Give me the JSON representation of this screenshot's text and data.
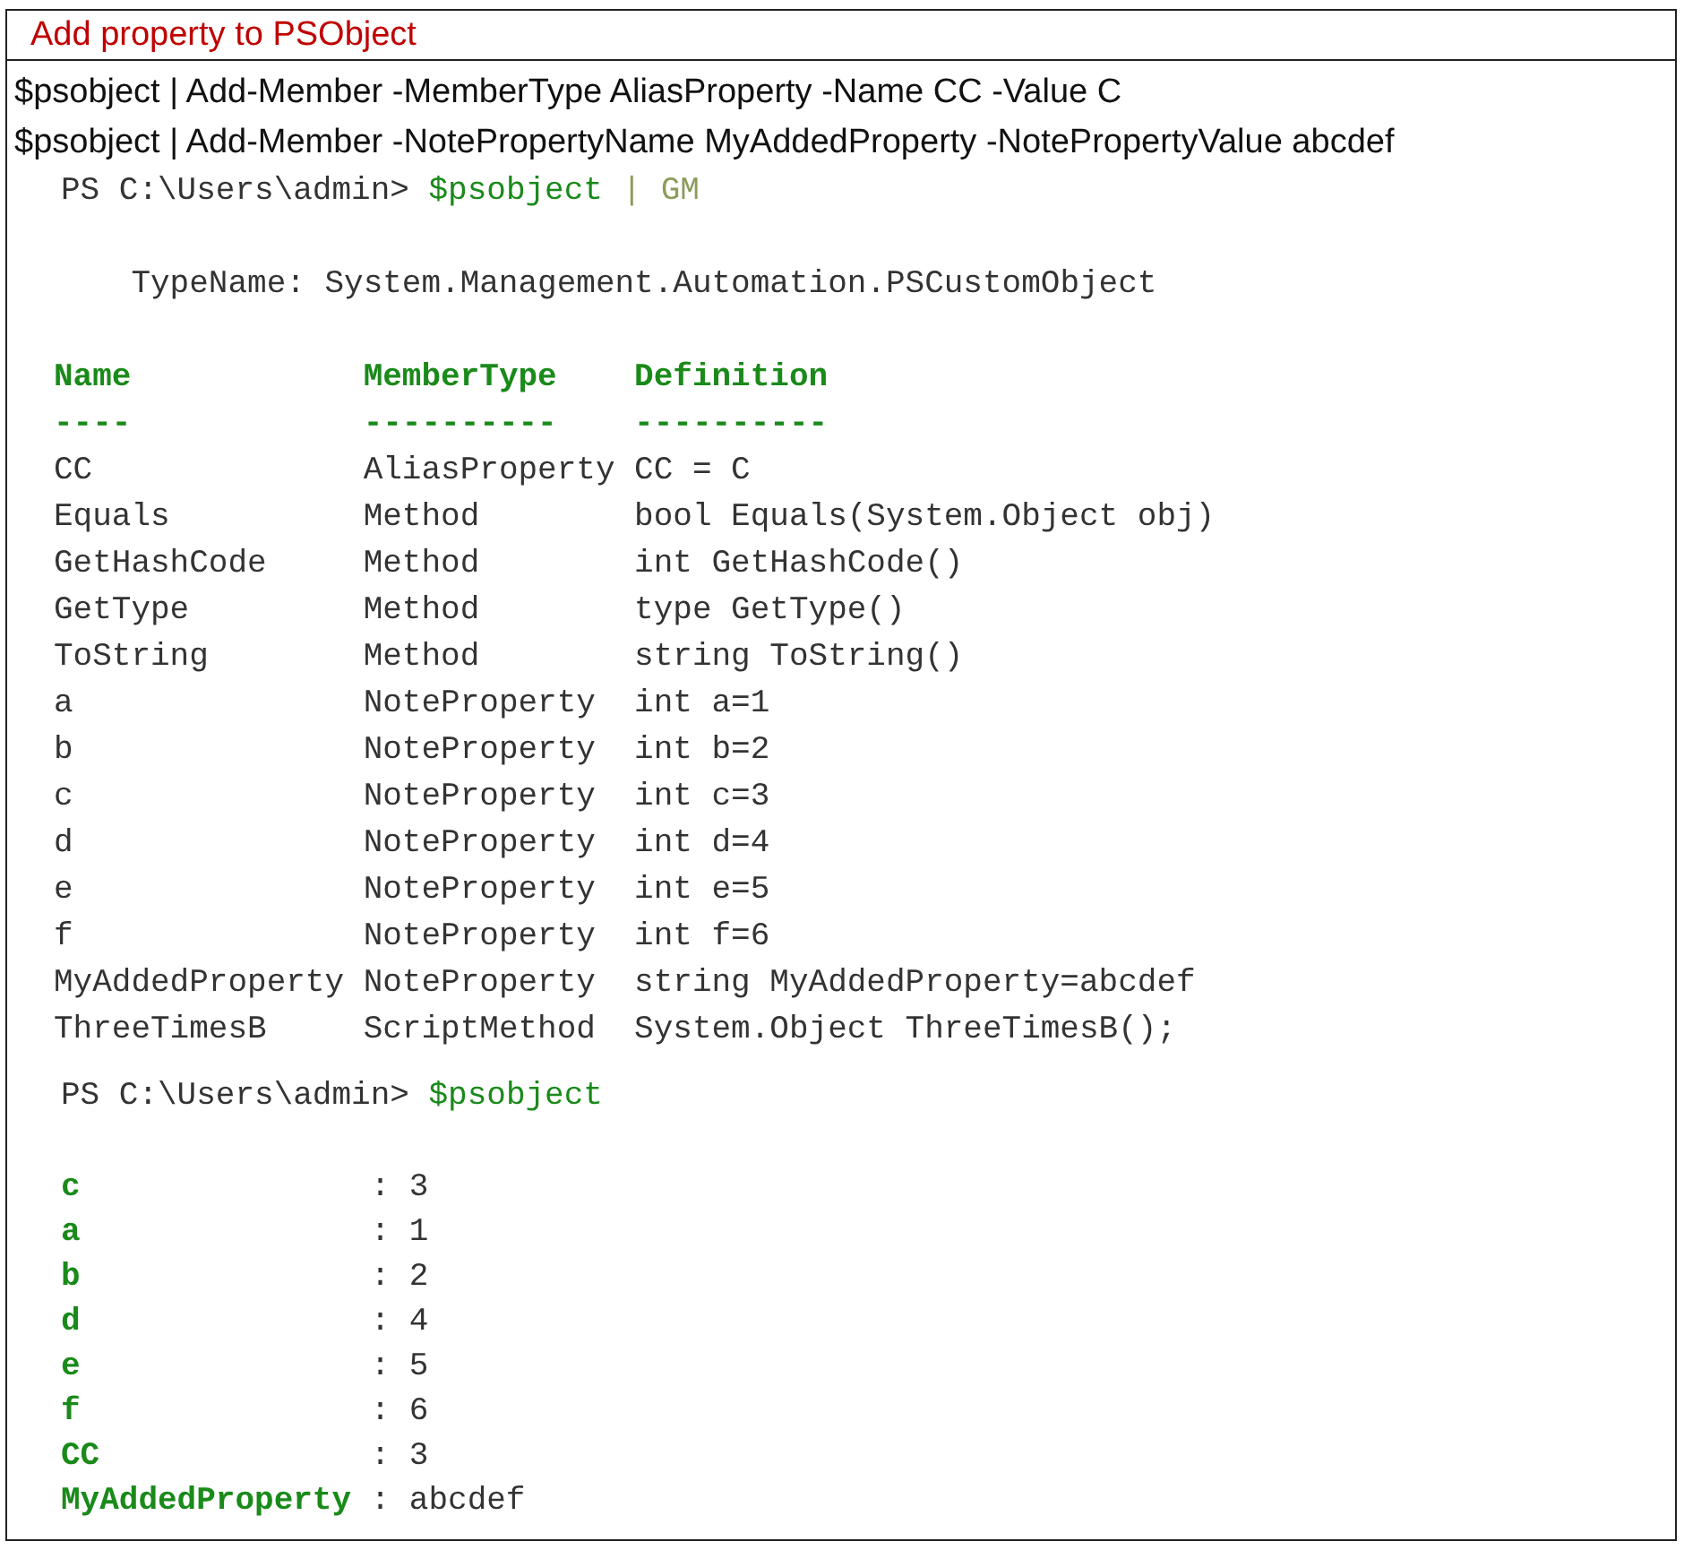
{
  "title": "Add property to PSObject",
  "commands": [
    "$psobject | Add-Member -MemberType AliasProperty -Name CC -Value C",
    "$psobject | Add-Member -NotePropertyName MyAddedProperty -NotePropertyValue abcdef"
  ],
  "console": {
    "prompt_1": [
      {
        "kind": "prompt",
        "text": "PS C:\\Users\\admin>"
      },
      {
        "kind": "variable",
        "text": "$psobject"
      },
      {
        "kind": "operator",
        "text": "| GM"
      }
    ],
    "type_name": "TypeName: System.Management.Automation.PSCustomObject",
    "table": {
      "columns": [
        "Name",
        "MemberType",
        "Definition"
      ],
      "separators": [
        "----",
        "----------",
        "----------"
      ],
      "rows": [
        {
          "name": "CC",
          "member_type": "AliasProperty",
          "definition": "CC = C"
        },
        {
          "name": "Equals",
          "member_type": "Method",
          "definition": "bool Equals(System.Object obj)"
        },
        {
          "name": "GetHashCode",
          "member_type": "Method",
          "definition": "int GetHashCode()"
        },
        {
          "name": "GetType",
          "member_type": "Method",
          "definition": "type GetType()"
        },
        {
          "name": "ToString",
          "member_type": "Method",
          "definition": "string ToString()"
        },
        {
          "name": "a",
          "member_type": "NoteProperty",
          "definition": "int a=1"
        },
        {
          "name": "b",
          "member_type": "NoteProperty",
          "definition": "int b=2"
        },
        {
          "name": "c",
          "member_type": "NoteProperty",
          "definition": "int c=3"
        },
        {
          "name": "d",
          "member_type": "NoteProperty",
          "definition": "int d=4"
        },
        {
          "name": "e",
          "member_type": "NoteProperty",
          "definition": "int e=5"
        },
        {
          "name": "f",
          "member_type": "NoteProperty",
          "definition": "int f=6"
        },
        {
          "name": "MyAddedProperty",
          "member_type": "NoteProperty",
          "definition": "string MyAddedProperty=abcdef"
        },
        {
          "name": "ThreeTimesB",
          "member_type": "ScriptMethod",
          "definition": "System.Object ThreeTimesB();"
        }
      ]
    },
    "prompt_2": [
      {
        "kind": "prompt",
        "text": "PS C:\\Users\\admin>"
      },
      {
        "kind": "variable",
        "text": "$psobject"
      }
    ],
    "separator": ":",
    "properties": [
      {
        "name": "c",
        "value": "3"
      },
      {
        "name": "a",
        "value": "1"
      },
      {
        "name": "b",
        "value": "2"
      },
      {
        "name": "d",
        "value": "4"
      },
      {
        "name": "e",
        "value": "5"
      },
      {
        "name": "f",
        "value": "6"
      },
      {
        "name": "CC",
        "value": "3"
      },
      {
        "name": "MyAddedProperty",
        "value": "abcdef"
      }
    ]
  }
}
